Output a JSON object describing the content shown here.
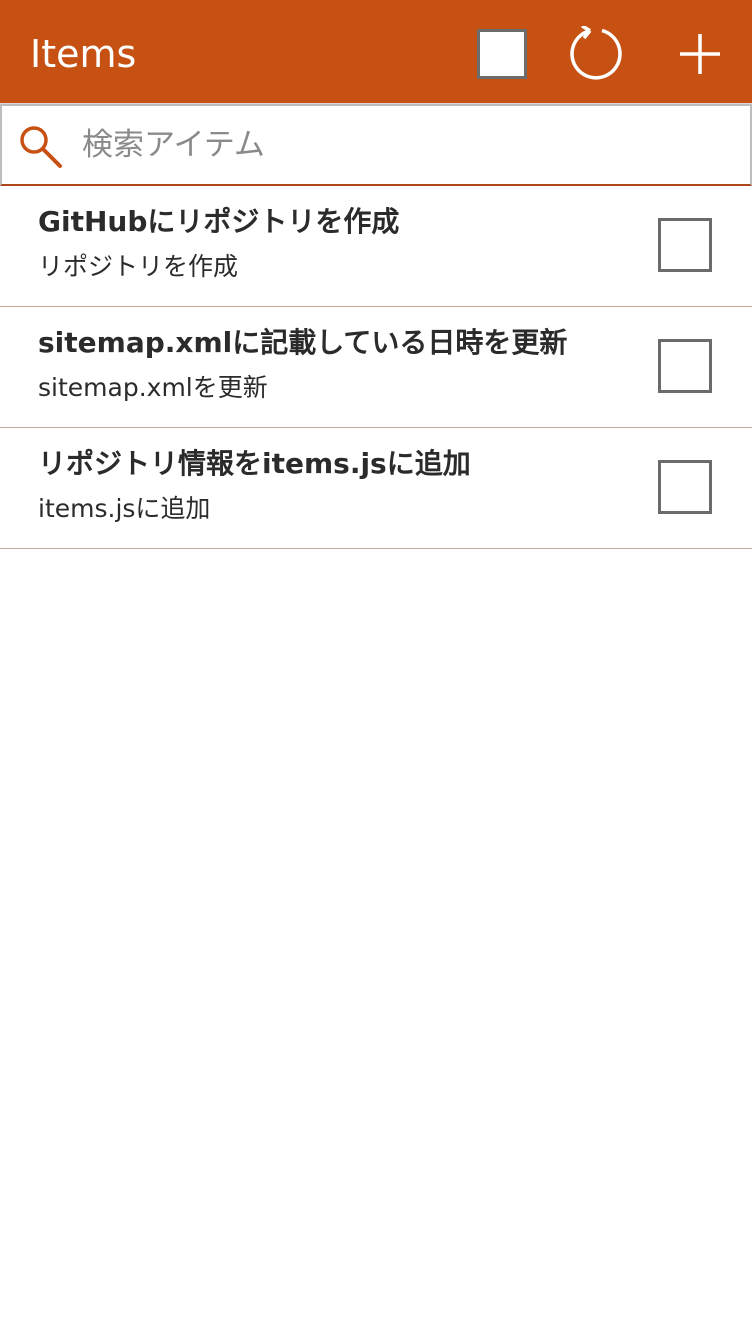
{
  "app_bar": {
    "title": "Items",
    "background": "#c75113",
    "actions": [
      {
        "name": "select-all",
        "icon": "checkbox-empty-icon"
      },
      {
        "name": "refresh",
        "icon": "refresh-icon"
      },
      {
        "name": "add",
        "icon": "plus-icon"
      }
    ]
  },
  "search": {
    "placeholder": "検索アイテム",
    "value": "",
    "icon": "search-icon",
    "icon_color": "#c75113"
  },
  "items": [
    {
      "title": "GitHubにリポジトリを作成",
      "subtitle": "リポジトリを作成",
      "checked": false
    },
    {
      "title": "sitemap.xmlに記載している日時を更新",
      "subtitle": "sitemap.xmlを更新",
      "checked": false
    },
    {
      "title": "リポジトリ情報をitems.jsに追加",
      "subtitle": "items.jsに追加",
      "checked": false
    }
  ]
}
